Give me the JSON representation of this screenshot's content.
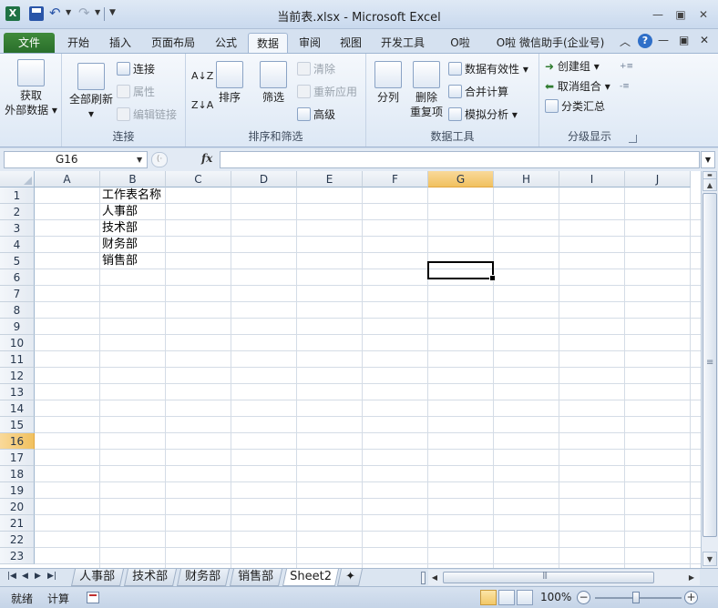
{
  "window": {
    "title": "当前表.xlsx - Microsoft Excel",
    "icon": "excel-icon",
    "qat": {
      "save": "save-icon",
      "undo": "undo-icon",
      "redo": "redo-icon"
    }
  },
  "ribbon_tabs": [
    {
      "label": "文件",
      "kind": "file"
    },
    {
      "label": "开始"
    },
    {
      "label": "插入"
    },
    {
      "label": "页面布局"
    },
    {
      "label": "公式"
    },
    {
      "label": "数据",
      "active": true
    },
    {
      "label": "审阅"
    },
    {
      "label": "视图"
    },
    {
      "label": "开发工具"
    },
    {
      "label": "O啦"
    },
    {
      "label": "O啦 微信助手(企业号)"
    }
  ],
  "ribbon": {
    "get_external": {
      "label_line1": "获取",
      "label_line2": "外部数据"
    },
    "connections": {
      "group_label": "连接",
      "refresh_all": "全部刷新",
      "connect": "连接",
      "properties": "属性",
      "edit_links": "编辑链接"
    },
    "sort_filter": {
      "group_label": "排序和筛选",
      "sort_az": "A↓Z",
      "sort_za": "Z↓A",
      "sort": "排序",
      "filter": "筛选",
      "clear": "清除",
      "reapply": "重新应用",
      "advanced": "高级"
    },
    "data_tools": {
      "group_label": "数据工具",
      "text_to_columns": "分列",
      "remove_duplicates_1": "删除",
      "remove_duplicates_2": "重复项",
      "data_validation": "数据有效性",
      "consolidate": "合并计算",
      "what_if": "模拟分析"
    },
    "outline": {
      "group_label": "分级显示",
      "group": "创建组",
      "ungroup": "取消组合",
      "subtotal": "分类汇总"
    }
  },
  "formula_bar": {
    "name_box": "G16",
    "fx": "fx",
    "formula": ""
  },
  "grid": {
    "columns": [
      "A",
      "B",
      "C",
      "D",
      "E",
      "F",
      "G",
      "H",
      "I",
      "J"
    ],
    "selected_column": "G",
    "rows": [
      "1",
      "2",
      "3",
      "4",
      "5",
      "6",
      "7",
      "8",
      "9",
      "10",
      "11",
      "12",
      "13",
      "14",
      "15",
      "16",
      "17",
      "18",
      "19",
      "20",
      "21",
      "22",
      "23"
    ],
    "selected_row": "16",
    "cells": {
      "B1": "工作表名称",
      "B2": "人事部",
      "B3": "技术部",
      "B4": "财务部",
      "B5": "销售部"
    }
  },
  "sheet_tabs": [
    {
      "label": "人事部"
    },
    {
      "label": "技术部"
    },
    {
      "label": "财务部"
    },
    {
      "label": "销售部"
    },
    {
      "label": "Sheet2",
      "active": true
    }
  ],
  "status_bar": {
    "ready": "就绪",
    "calculate": "计算",
    "zoom": "100%"
  }
}
